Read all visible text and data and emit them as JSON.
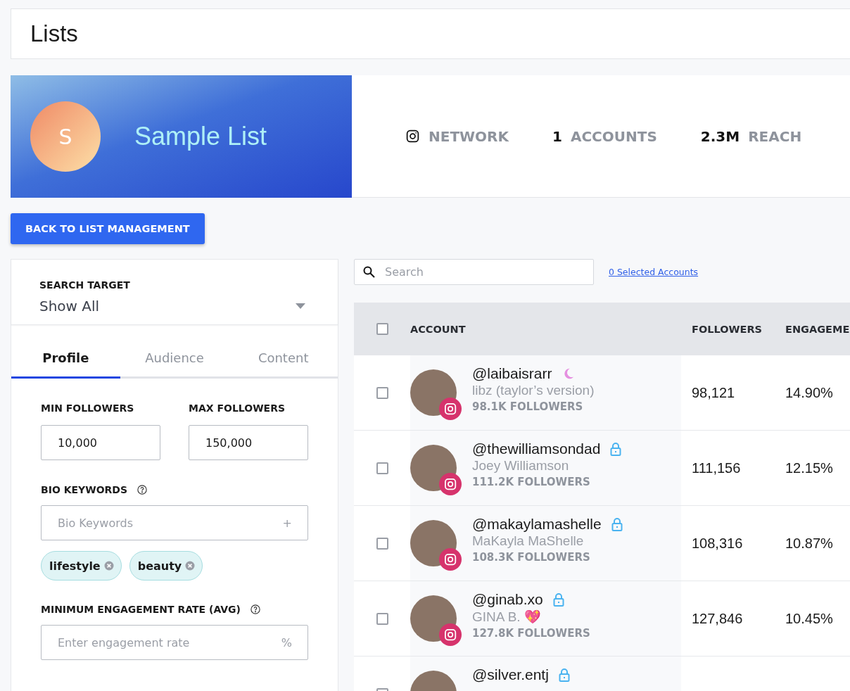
{
  "page": {
    "title": "Lists"
  },
  "list_banner": {
    "avatar_letter": "S",
    "name": "Sample List"
  },
  "stats": [
    {
      "kind": "network",
      "label": "NETWORK"
    },
    {
      "kind": "count",
      "value": "1",
      "label": "ACCOUNTS"
    },
    {
      "kind": "count",
      "value": "2.3M",
      "label": "REACH"
    }
  ],
  "back_button": "BACK TO LIST MANAGEMENT",
  "filters": {
    "search_target": {
      "label": "SEARCH TARGET",
      "value": "Show All"
    },
    "tabs": [
      {
        "label": "Profile",
        "selected": true
      },
      {
        "label": "Audience",
        "selected": false
      },
      {
        "label": "Content",
        "selected": false
      }
    ],
    "min_followers": {
      "label": "MIN FOLLOWERS",
      "value": "10,000"
    },
    "max_followers": {
      "label": "MAX FOLLOWERS",
      "value": "150,000"
    },
    "bio_keywords": {
      "label": "BIO KEYWORDS",
      "placeholder": "Bio Keywords",
      "add": "+",
      "tags": [
        "lifestyle",
        "beauty"
      ]
    },
    "engagement": {
      "label": "MINIMUM ENGAGEMENT RATE (AVG)",
      "placeholder": "Enter engagement rate",
      "unit": "%"
    }
  },
  "search": {
    "placeholder": "Search"
  },
  "selected_link": "0 Selected Accounts",
  "table": {
    "select_all_checked": false,
    "columns": [
      "ACCOUNT",
      "FOLLOWERS",
      "ENGAGEME"
    ],
    "rows": [
      {
        "checked": false,
        "handle": "@laibaisrarr",
        "kind": "moon",
        "name": "libz (taylor’s version)",
        "followers_label": "98.1K FOLLOWERS",
        "followers": "98,121",
        "engagement": "14.90%"
      },
      {
        "checked": false,
        "handle": "@thewilliamsondad",
        "kind": "lock",
        "name": "Joey Williamson",
        "followers_label": "111.2K FOLLOWERS",
        "followers": "111,156",
        "engagement": "12.15%"
      },
      {
        "checked": false,
        "handle": "@makaylamashelle",
        "kind": "lock",
        "name": "MaKayla MaShelle",
        "followers_label": "108.3K FOLLOWERS",
        "followers": "108,316",
        "engagement": "10.87%"
      },
      {
        "checked": false,
        "handle": "@ginab.xo",
        "kind": "lock",
        "name": "GINA B. 💖",
        "followers_label": "127.8K FOLLOWERS",
        "followers": "127,846",
        "engagement": "10.45%"
      },
      {
        "checked": false,
        "handle": "@silver.entj",
        "kind": "lock"
      }
    ]
  }
}
